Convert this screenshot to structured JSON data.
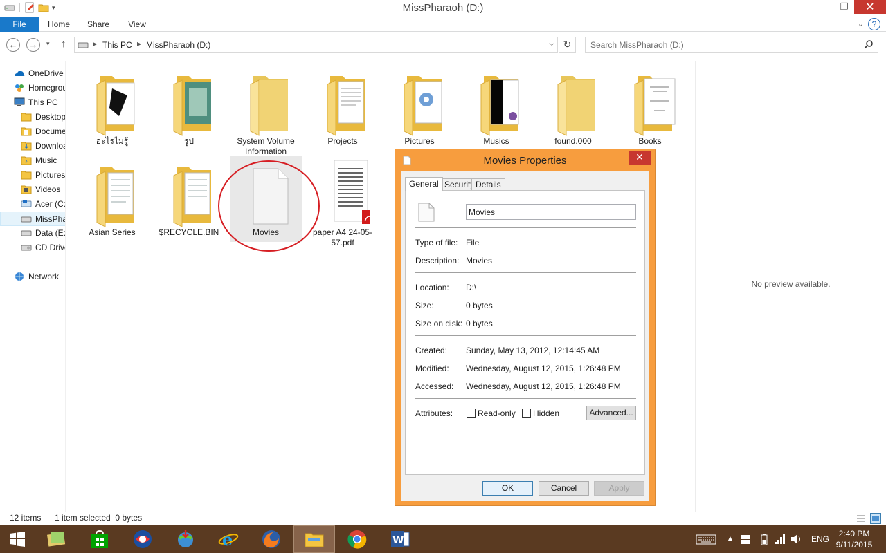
{
  "window": {
    "title": "MissPharaoh (D:)",
    "minimize": "—",
    "maximize": "❐",
    "close": "✕"
  },
  "ribbon": {
    "tabs": [
      "File",
      "Home",
      "Share",
      "View"
    ],
    "help": "?"
  },
  "address": {
    "crumbs": [
      "This PC",
      "MissPharaoh (D:)"
    ],
    "search_placeholder": "Search MissPharaoh (D:)"
  },
  "nav": {
    "items": [
      {
        "label": "OneDrive",
        "icon": "onedrive-icon"
      },
      {
        "label": "Homegroup",
        "icon": "homegroup-icon"
      },
      {
        "label": "This PC",
        "icon": "pc-icon"
      },
      {
        "label": "Desktop",
        "icon": "folder-icon"
      },
      {
        "label": "Documents",
        "icon": "folder-icon"
      },
      {
        "label": "Downloads",
        "icon": "folder-icon"
      },
      {
        "label": "Music",
        "icon": "music-folder-icon"
      },
      {
        "label": "Pictures",
        "icon": "folder-icon"
      },
      {
        "label": "Videos",
        "icon": "video-folder-icon"
      },
      {
        "label": "Acer (C:)",
        "icon": "drive-icon"
      },
      {
        "label": "MissPharaoh (D:)",
        "icon": "drive-icon"
      },
      {
        "label": "Data (E:)",
        "icon": "drive-icon"
      },
      {
        "label": "CD Drive",
        "icon": "cd-drive-icon"
      },
      {
        "label": "Network",
        "icon": "network-icon"
      }
    ]
  },
  "files": [
    {
      "label": "อะไรไม่รู้",
      "kind": "folder"
    },
    {
      "label": "รูป",
      "kind": "folder"
    },
    {
      "label": "System Volume Information",
      "kind": "folder"
    },
    {
      "label": "Projects",
      "kind": "folder"
    },
    {
      "label": "Pictures",
      "kind": "folder"
    },
    {
      "label": "Musics",
      "kind": "folder"
    },
    {
      "label": "found.000",
      "kind": "folder"
    },
    {
      "label": "Books",
      "kind": "folder"
    },
    {
      "label": "Asian Series",
      "kind": "folder"
    },
    {
      "label": "$RECYCLE.BIN",
      "kind": "folder"
    },
    {
      "label": "Movies",
      "kind": "file",
      "selected": true
    },
    {
      "label": "paper A4 24-05-57.pdf",
      "kind": "pdf"
    }
  ],
  "preview": {
    "text": "No preview available."
  },
  "status": {
    "count": "12 items",
    "selection": "1 item selected  0 bytes"
  },
  "dialog": {
    "title": "Movies Properties",
    "tabs": [
      "General",
      "Security",
      "Details"
    ],
    "name": "Movies",
    "rows": [
      {
        "label": "Type of file:",
        "value": "File"
      },
      {
        "label": "Description:",
        "value": "Movies"
      },
      {
        "label": "Location:",
        "value": "D:\\"
      },
      {
        "label": "Size:",
        "value": "0 bytes"
      },
      {
        "label": "Size on disk:",
        "value": "0 bytes"
      },
      {
        "label": "Created:",
        "value": "Sunday, May 13, 2012, 12:14:45 AM"
      },
      {
        "label": "Modified:",
        "value": "Wednesday, August 12, 2015, 1:26:48 PM"
      },
      {
        "label": "Accessed:",
        "value": "Wednesday, August 12, 2015, 1:26:48 PM"
      }
    ],
    "attributes_label": "Attributes:",
    "readonly_label": "Read-only",
    "hidden_label": "Hidden",
    "advanced_label": "Advanced...",
    "ok_label": "OK",
    "cancel_label": "Cancel",
    "apply_label": "Apply"
  },
  "taskbar": {
    "language": "ENG",
    "time": "2:40 PM",
    "date": "9/11/2015"
  },
  "colors": {
    "file_tab": "#1979ca",
    "dialog_frame": "#f79d3e",
    "close_button": "#c7372f",
    "taskbar": "#5a3a21",
    "annotation_circle": "#d61e23"
  }
}
